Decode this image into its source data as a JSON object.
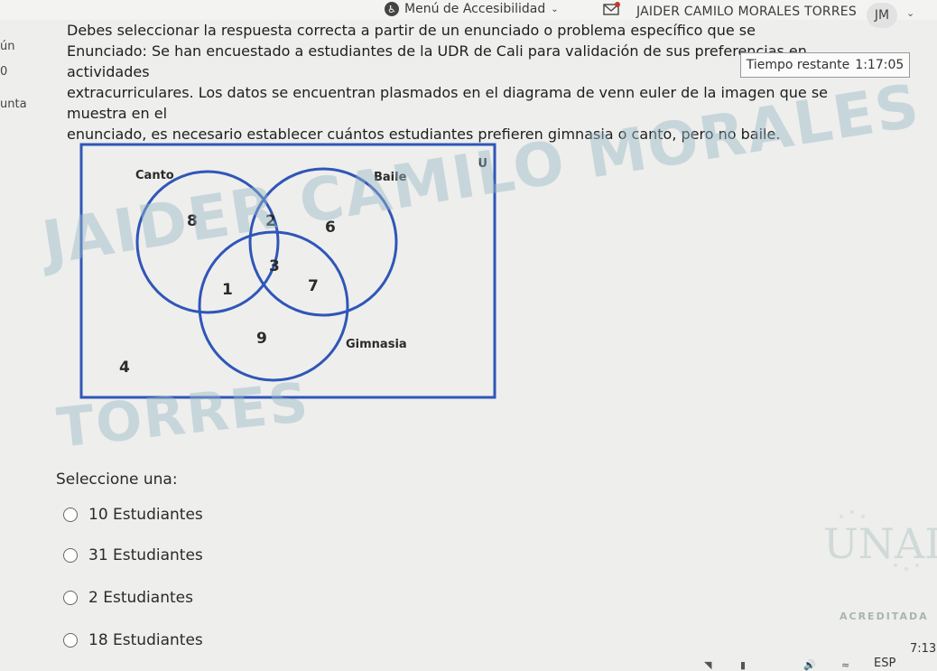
{
  "topbar": {
    "accessibility_menu": "Menú de Accesibilidad",
    "user_name": "JAIDER CAMILO MORALES TORRES",
    "avatar_initials": "JM"
  },
  "left_clip": [
    "ún",
    "0",
    "unta"
  ],
  "question": {
    "line1": "Debes seleccionar la respuesta correcta a partir de un enunciado o problema específico que se",
    "line2": "Enunciado: Se han encuestado a estudiantes de la UDR de Cali para validación de sus preferencias en actividades",
    "line3": "extracurriculares. Los datos se encuentran plasmados en el diagrama de venn euler de la imagen que se muestra en el",
    "line4": "enunciado, es necesario establecer cuántos estudiantes prefieren gimnasia o canto, pero no baile."
  },
  "timer": {
    "label": "Tiempo restante",
    "value": "1:17:05"
  },
  "venn": {
    "universe_label": "U",
    "sets": {
      "canto": "Canto",
      "baile": "Baile",
      "gimnasia": "Gimnasia"
    },
    "regions": {
      "canto_only": "8",
      "canto_baile": "2",
      "baile_only": "6",
      "all_three": "3",
      "canto_gimnasia": "1",
      "baile_gimnasia": "7",
      "gimnasia_only": "9",
      "outside": "4"
    },
    "stroke_color": "#2f56b8"
  },
  "watermark": {
    "line1": "JAIDER CAMILO MORALES",
    "line2": "TORRES"
  },
  "select_prompt": "Seleccione una:",
  "options": [
    {
      "label": "10 Estudiantes"
    },
    {
      "label": "31 Estudiantes"
    },
    {
      "label": "2 Estudiantes"
    },
    {
      "label": "18 Estudiantes"
    }
  ],
  "logo": {
    "name": "UNAD",
    "accreditation": "ACREDITADA"
  },
  "taskbar": {
    "time": "7:13",
    "language": "ESP"
  }
}
